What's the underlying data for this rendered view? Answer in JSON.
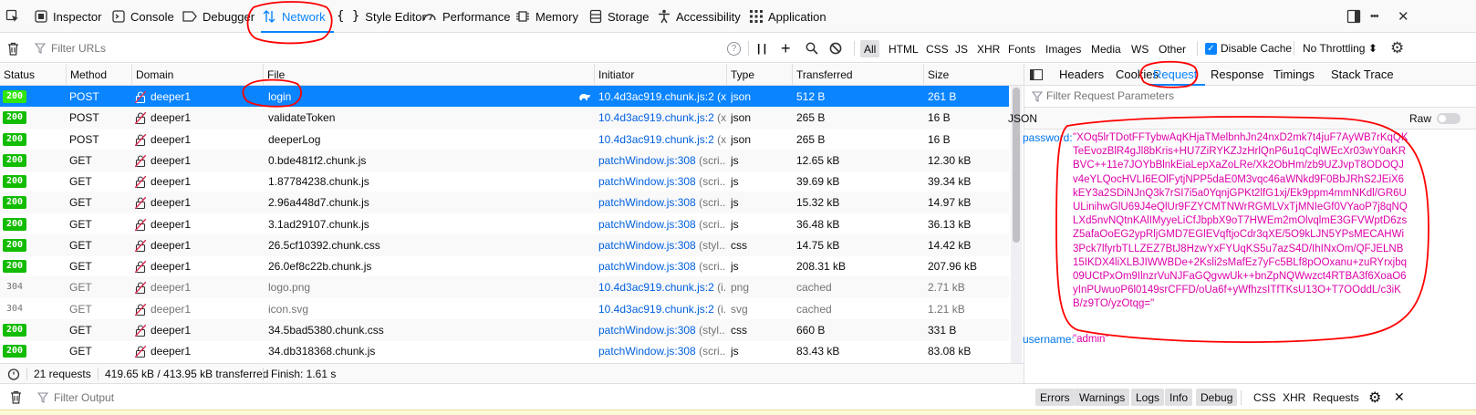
{
  "toolbar": {
    "tabs": [
      "Inspector",
      "Console",
      "Debugger",
      "Network",
      "Style Editor",
      "Performance",
      "Memory",
      "Storage",
      "Accessibility",
      "Application"
    ],
    "active_tab": "Network",
    "more_label": "•••",
    "close_label": "✕"
  },
  "filterbar": {
    "filter_placeholder": "Filter URLs",
    "help_label": "?",
    "pause_label": "| |",
    "types": [
      "All",
      "HTML",
      "CSS",
      "JS",
      "XHR",
      "Fonts",
      "Images",
      "Media",
      "WS",
      "Other"
    ],
    "active_type": "All",
    "disable_cache_label": "Disable Cache",
    "disable_cache_checked": true,
    "throttling_label": "No Throttling ⬍"
  },
  "table": {
    "columns": [
      "Status",
      "Method",
      "Domain",
      "File",
      "Initiator",
      "Type",
      "Transferred",
      "Size"
    ],
    "rows": [
      {
        "status": "200",
        "method": "POST",
        "domain": "deeper1",
        "file": "login",
        "initiator": "10.4d3ac919.chunk.js:2",
        "initiator_suffix": " (x...",
        "type": "json",
        "transferred": "512 B",
        "size": "261 B",
        "selected": true
      },
      {
        "status": "200",
        "method": "POST",
        "domain": "deeper1",
        "file": "validateToken",
        "initiator": "10.4d3ac919.chunk.js:2",
        "initiator_suffix": " (x...",
        "type": "json",
        "transferred": "265 B",
        "size": "16 B"
      },
      {
        "status": "200",
        "method": "POST",
        "domain": "deeper1",
        "file": "deeperLog",
        "initiator": "10.4d3ac919.chunk.js:2",
        "initiator_suffix": " (x...",
        "type": "json",
        "transferred": "265 B",
        "size": "16 B"
      },
      {
        "status": "200",
        "method": "GET",
        "domain": "deeper1",
        "file": "0.bde481f2.chunk.js",
        "initiator": "patchWindow.js:308",
        "initiator_suffix": " (scri...",
        "type": "js",
        "transferred": "12.65 kB",
        "size": "12.30 kB"
      },
      {
        "status": "200",
        "method": "GET",
        "domain": "deeper1",
        "file": "1.87784238.chunk.js",
        "initiator": "patchWindow.js:308",
        "initiator_suffix": " (scri...",
        "type": "js",
        "transferred": "39.69 kB",
        "size": "39.34 kB"
      },
      {
        "status": "200",
        "method": "GET",
        "domain": "deeper1",
        "file": "2.96a448d7.chunk.js",
        "initiator": "patchWindow.js:308",
        "initiator_suffix": " (scri...",
        "type": "js",
        "transferred": "15.32 kB",
        "size": "14.97 kB"
      },
      {
        "status": "200",
        "method": "GET",
        "domain": "deeper1",
        "file": "3.1ad29107.chunk.js",
        "initiator": "patchWindow.js:308",
        "initiator_suffix": " (scri...",
        "type": "js",
        "transferred": "36.48 kB",
        "size": "36.13 kB"
      },
      {
        "status": "200",
        "method": "GET",
        "domain": "deeper1",
        "file": "26.5cf10392.chunk.css",
        "initiator": "patchWindow.js:308",
        "initiator_suffix": " (styl...",
        "type": "css",
        "transferred": "14.75 kB",
        "size": "14.42 kB"
      },
      {
        "status": "200",
        "method": "GET",
        "domain": "deeper1",
        "file": "26.0ef8c22b.chunk.js",
        "initiator": "patchWindow.js:308",
        "initiator_suffix": " (scri...",
        "type": "js",
        "transferred": "208.31 kB",
        "size": "207.96 kB"
      },
      {
        "status": "304",
        "method": "GET",
        "domain": "deeper1",
        "file": "logo.png",
        "initiator": "10.4d3ac919.chunk.js:2",
        "initiator_suffix": " (i...",
        "type": "png",
        "transferred": "cached",
        "size": "2.71 kB",
        "cached": true
      },
      {
        "status": "304",
        "method": "GET",
        "domain": "deeper1",
        "file": "icon.svg",
        "initiator": "10.4d3ac919.chunk.js:2",
        "initiator_suffix": " (i...",
        "type": "svg",
        "transferred": "cached",
        "size": "1.21 kB",
        "cached": true
      },
      {
        "status": "200",
        "method": "GET",
        "domain": "deeper1",
        "file": "34.5bad5380.chunk.css",
        "initiator": "patchWindow.js:308",
        "initiator_suffix": " (styl...",
        "type": "css",
        "transferred": "660 B",
        "size": "331 B"
      },
      {
        "status": "200",
        "method": "GET",
        "domain": "deeper1",
        "file": "34.db318368.chunk.js",
        "initiator": "patchWindow.js:308",
        "initiator_suffix": " (scri...",
        "type": "js",
        "transferred": "83.43 kB",
        "size": "83.08 kB"
      }
    ]
  },
  "statusbar": {
    "requests": "21 requests",
    "transferred": "419.65 kB / 413.95 kB transferred",
    "finish": "Finish: 1.61 s"
  },
  "panel": {
    "tabs": [
      "Headers",
      "Cookies",
      "Request",
      "Response",
      "Timings",
      "Stack Trace"
    ],
    "active_tab": "Request",
    "filter_placeholder": "Filter Request Parameters",
    "json_label": "JSON",
    "raw_label": "Raw",
    "password_key": "password:",
    "password_value": "\"XOq5lrTDotFFTybwAqKHjaTMelbnhJn24nxD2mk7t4juF7AyWB7rKqQKTeEvozBlR4gJl8bKris+HU7ZiRYKZJzHrlQnP6u1qCqlWEcXr03wY0aKRBVC++11e7JOYbBlnkEiaLepXaZoLRe/Xk2ObHm/zb9UZJvpT8ODOQJv4eYLQocHVLI6EOlFytjNPP5daE0M3vqc46aWNkd9F0BbJRhS2JEiX6kEY3a2SDiNJnQ3k7rSI7i5a0YqnjGPKt2lfG1xj/Ek9ppm4mmNKdl/GR6UULinihwGlU69J4eQlUr9FZYCMTNWrRGMLVxTjMNIeGf0VYaoP7j8qNQLXd5nvNQtnKAlIMyyeLiCfJbpbX9oT7HWEm2mOlvqlmE3GFVWptD6zsZ5afaOoEG2ypRljGMD7EGlEVqftjoCdr3qXE/5O9kLJN5YPsMECAHWi3Pck7lfyrbTLLZEZ7BtJ8HzwYxFYUqKS5u7azS4D/IhINxOm/QFJELNB15IKDX4liXLBJIWWBDe+2Ksli2sMafEz7yFc5BLf8pOOxanu+zuRYrxjbq09UCtPxOm9IlnzrVuNJFaGQgvwUk++bnZpNQWwzct4RTBA3f6XoaO6yInPUwuoP6l0149srCFFD/oUa6f+yWfhzsITfTKsU13O+T7OOddL/c3iKB/z9TO/yzOtqg=\"",
    "username_key": "username:",
    "username_value": "\"admin\""
  },
  "consolebar": {
    "filter_placeholder": "Filter Output",
    "buttons": [
      "Errors",
      "Warnings",
      "Logs",
      "Info",
      "Debug"
    ],
    "extra": [
      "CSS",
      "XHR",
      "Requests"
    ]
  },
  "colors": {
    "accent": "#0a84ff",
    "selected_row": "#0a84ff",
    "status_ok": "#12bc00",
    "json_key": "#0074e8",
    "json_string": "#dd00a9",
    "annotation": "#ff0000"
  }
}
